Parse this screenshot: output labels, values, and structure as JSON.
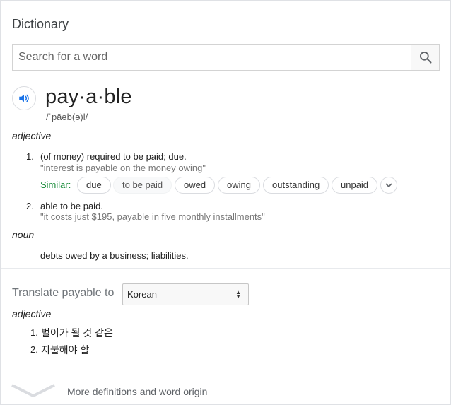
{
  "header": {
    "title": "Dictionary"
  },
  "search": {
    "placeholder": "Search for a word",
    "value": "",
    "button_icon": "search-icon"
  },
  "entry": {
    "speaker_icon": "speaker-icon",
    "headword": "pay·a·ble",
    "phonetic": "/ˈpāəb(ə)l/",
    "senses": [
      {
        "pos": "adjective",
        "definitions": [
          {
            "num": "1.",
            "text": "(of money) required to be paid; due.",
            "example": "\"interest is payable on the money owing\"",
            "similar_label": "Similar:",
            "similar": [
              "due",
              "to be paid",
              "owed",
              "owing",
              "outstanding",
              "unpaid"
            ]
          },
          {
            "num": "2.",
            "text": "able to be paid.",
            "example": "\"it costs just $195, payable in five monthly installments\""
          }
        ]
      },
      {
        "pos": "noun",
        "definitions": [
          {
            "text": "debts owed by a business; liabilities."
          }
        ]
      }
    ]
  },
  "translate": {
    "label": "Translate payable to",
    "language": "Korean",
    "pos": "adjective",
    "items": [
      {
        "num": "1.",
        "text": "벌이가 될 것 같은"
      },
      {
        "num": "2.",
        "text": "지불해야 할"
      }
    ]
  },
  "footer": {
    "link": "More definitions and word origin",
    "icon": "chevron-down-icon"
  },
  "colors": {
    "accent_blue": "#1a73e8",
    "similar_green": "#1e8e3e",
    "muted": "#70757a"
  }
}
